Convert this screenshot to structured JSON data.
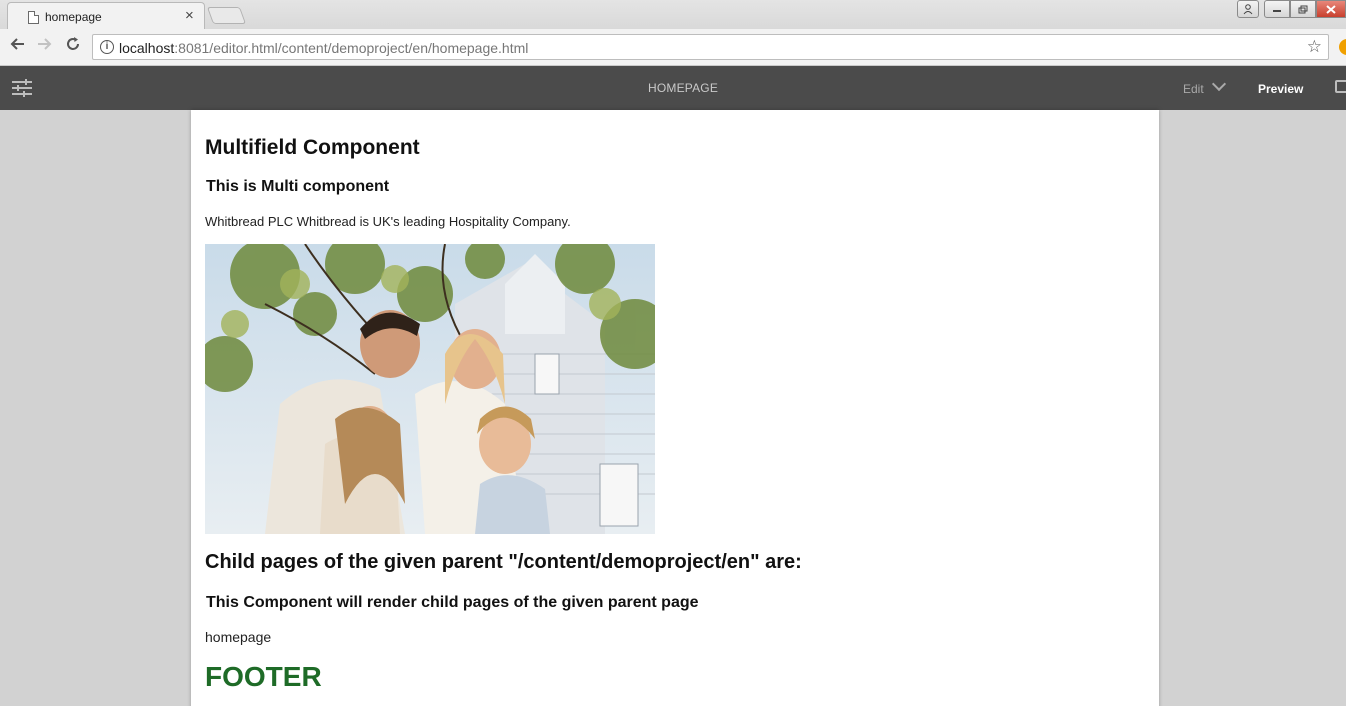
{
  "browser": {
    "tab_title": "homepage",
    "tab_close": "×",
    "url_host": "localhost",
    "url_rest": ":8081/editor.html/content/demoproject/en/homepage.html",
    "colors": {
      "chrome": "#f2f2f2",
      "tabstrip": "#dcdcdc",
      "close_button": "#c8402e"
    }
  },
  "editor": {
    "page_name": "HOMEPAGE",
    "mode_edit": "Edit",
    "mode_preview": "Preview",
    "icons": [
      "side-panel-icon",
      "annotations-icon",
      "chevron-down-icon"
    ],
    "colors": {
      "bar": "#4b4b4b"
    }
  },
  "page": {
    "multifield_heading": "Multifield Component",
    "multifield_subheading": "This is Multi component",
    "multifield_text": "Whitbread PLC Whitbread is UK's leading Hospitality Company.",
    "child_heading": "Child pages of the given parent \"/content/demoproject/en\" are:",
    "child_subheading": "This Component will render child pages of the given parent page",
    "child_item": "homepage",
    "footer": "FOOTER",
    "colors": {
      "footer": "#1e6b27"
    }
  }
}
